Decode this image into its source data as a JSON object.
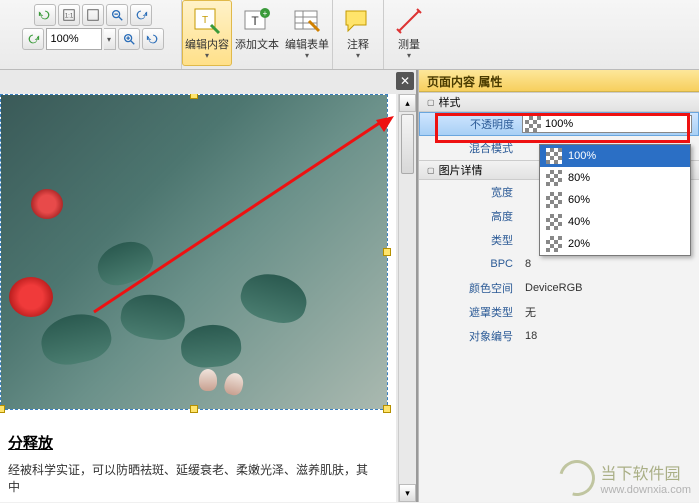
{
  "toolbar": {
    "zoom_value": "100%",
    "edit_content": "编辑内容",
    "add_text": "添加文本",
    "edit_form": "编辑表单",
    "annotate": "注释",
    "measure": "测量"
  },
  "panel": {
    "title": "页面内容 属性",
    "section_style": "样式",
    "section_image": "图片详情",
    "labels": {
      "opacity": "不透明度",
      "blend": "混合模式",
      "width": "宽度",
      "height": "高度",
      "type": "类型",
      "bpc": "BPC",
      "colorspace": "颜色空间",
      "masktype": "遮罩类型",
      "objnum": "对象编号"
    },
    "values": {
      "opacity": "100%",
      "bpc": "8",
      "colorspace": "DeviceRGB",
      "masktype": "无",
      "objnum": "18"
    }
  },
  "dropdown": {
    "items": [
      "100%",
      "80%",
      "60%",
      "40%",
      "20%"
    ],
    "selected": "100%"
  },
  "doc": {
    "heading": "分释放",
    "paragraph": "经被科学实证，可以防晒祛斑、延缓衰老、柔嫩光泽、滋养肌肤，其中"
  },
  "watermark": {
    "name": "当下软件园",
    "url": "www.downxia.com"
  }
}
